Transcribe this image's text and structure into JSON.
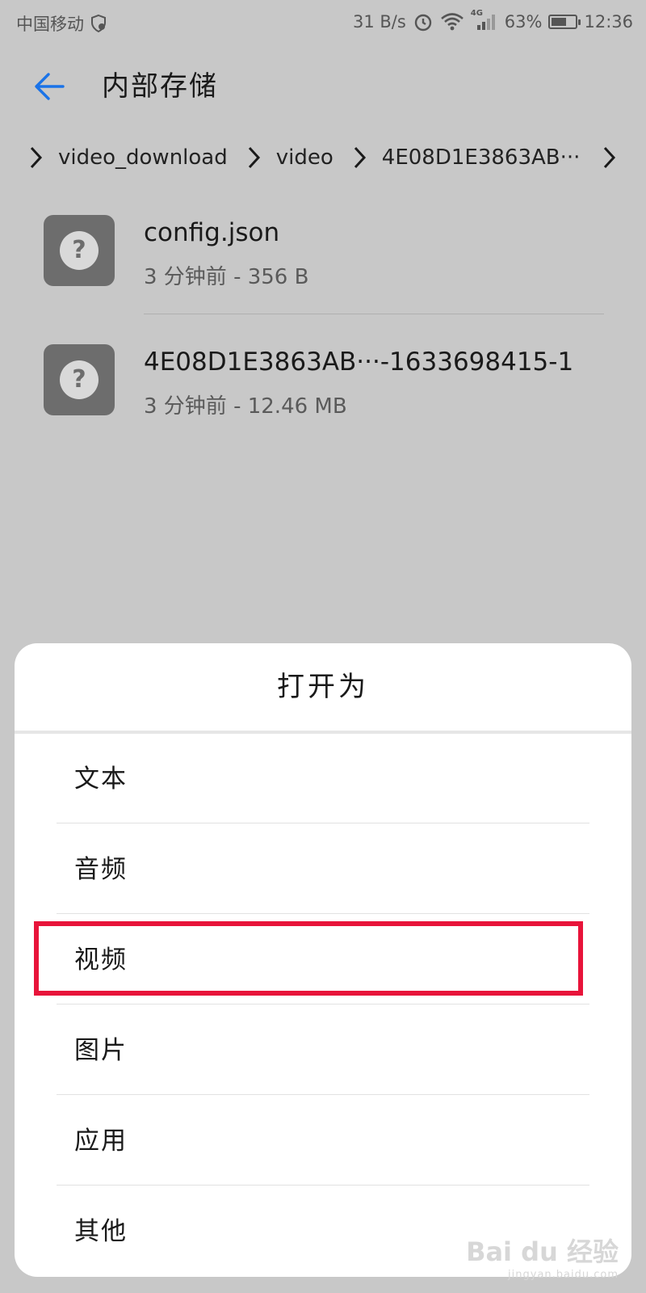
{
  "status_bar": {
    "carrier": "中国移动",
    "net_speed": "31 B/s",
    "network_type": "4G",
    "battery": "63%",
    "battery_level": 0.63,
    "time": "12:36",
    "icons": [
      "shield-icon",
      "alarm-icon",
      "wifi-icon",
      "signal-icon",
      "battery-icon"
    ]
  },
  "app_bar": {
    "back_icon": "back-arrow-icon",
    "title": "内部存储"
  },
  "breadcrumb": {
    "items": [
      "video_download",
      "video",
      "4E08D1E3863AB···"
    ]
  },
  "files": [
    {
      "name": "config.json",
      "meta": "3 分钟前 - 356 B",
      "icon": "unknown-file-icon"
    },
    {
      "name": "4E08D1E3863AB···-1633698415-1",
      "meta": "3 分钟前 - 12.46 MB",
      "icon": "unknown-file-icon"
    }
  ],
  "sheet": {
    "title": "打开为",
    "options": [
      "文本",
      "音频",
      "视频",
      "图片",
      "应用",
      "其他"
    ],
    "highlighted_option": "视频",
    "highlight_color": "#e8143a"
  },
  "watermark": {
    "logo": "Bai du 经验",
    "sub": "jingyan.baidu.com"
  },
  "colors": {
    "accent": "#1a73e8",
    "scrim": "#c8c8c8",
    "sheet_bg": "#ffffff"
  }
}
